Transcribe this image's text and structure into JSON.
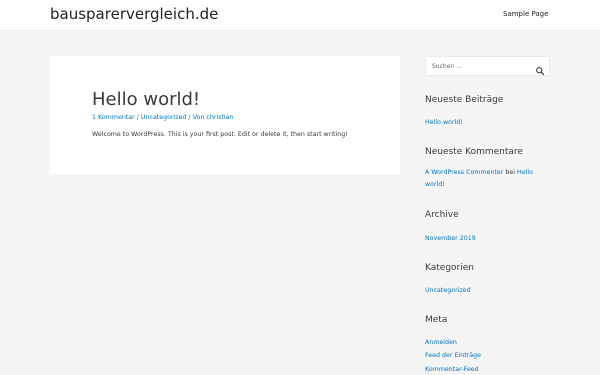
{
  "header": {
    "site_title": "bausparervergleich.de",
    "nav": [
      "Sample Page"
    ]
  },
  "post": {
    "title": "Hello world!",
    "meta": {
      "comments": "1 Kommentar",
      "category": "Uncategorized",
      "author_prefix": "Von",
      "author": "christian",
      "separator": "/"
    },
    "body": "Welcome to WordPress. This is your first post. Edit or delete it, then start writing!"
  },
  "sidebar": {
    "search": {
      "placeholder": "Suchen …",
      "icon": "search-icon"
    },
    "recent_posts": {
      "title": "Neueste Beiträge",
      "items": [
        "Hello world!"
      ]
    },
    "recent_comments": {
      "title": "Neueste Kommentare",
      "author": "A WordPress Commenter",
      "connector": "bei",
      "post_line1": "Hello",
      "post_line2": "world!"
    },
    "archive": {
      "title": "Archive",
      "items": [
        "November 2019"
      ]
    },
    "categories": {
      "title": "Kategorien",
      "items": [
        "Uncategorized"
      ]
    },
    "meta": {
      "title": "Meta",
      "items": [
        "Anmelden",
        "Feed der Einträge",
        "Kommentar-Feed"
      ]
    }
  },
  "colors": {
    "background": "#f5f5f5",
    "link": "#0274be",
    "text": "#3a3a3a"
  }
}
